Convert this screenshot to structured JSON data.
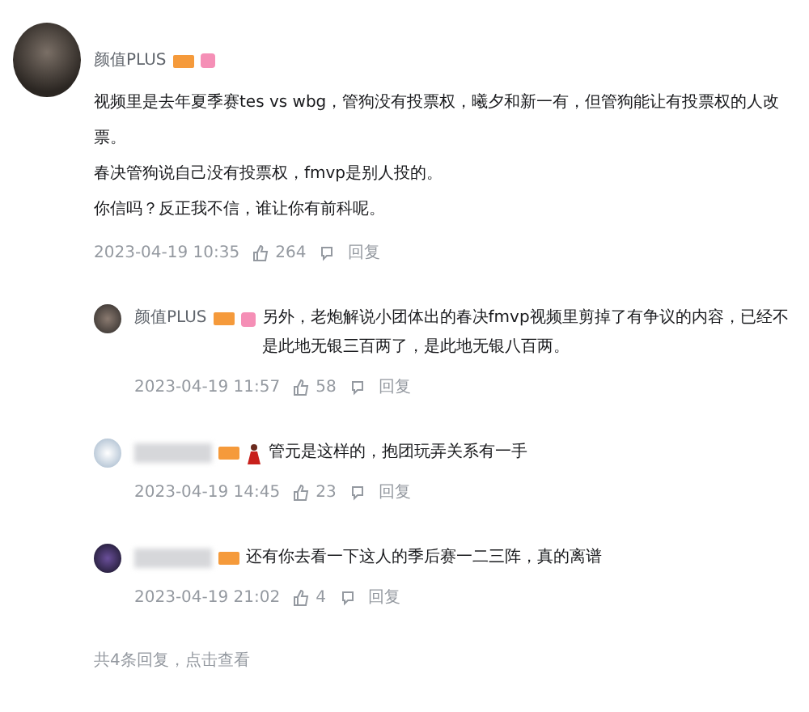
{
  "comment": {
    "user": "颜值PLUS",
    "up_badge": true,
    "lines": [
      "视频里是去年夏季赛tes vs wbg，管狗没有投票权，曦夕和新一有，但管狗能让有投票权的人改票。",
      "春决管狗说自己没有投票权，fmvp是别人投的。",
      "你信吗？反正我不信，谁让你有前科呢。"
    ],
    "time": "2023-04-19 10:35",
    "likes": "264",
    "reply_label": "回复"
  },
  "replies": [
    {
      "user": "颜值PLUS",
      "name_blurred": false,
      "up_badge": true,
      "emoji": false,
      "text": "另外，老炮解说小团体出的春决fmvp视频里剪掉了有争议的内容，已经不是此地无银三百两了，是此地无银八百两。",
      "time": "2023-04-19 11:57",
      "likes": "58",
      "reply_label": "回复"
    },
    {
      "name_blurred": true,
      "up_badge": false,
      "emoji": true,
      "text": "管元是这样的，抱团玩弄关系有一手",
      "time": "2023-04-19 14:45",
      "likes": "23",
      "reply_label": "回复"
    },
    {
      "name_blurred": true,
      "up_badge": false,
      "emoji": false,
      "text": "还有你去看一下这人的季后赛一二三阵，真的离谱",
      "time": "2023-04-19 21:02",
      "likes": "4",
      "reply_label": "回复"
    }
  ],
  "footer": "共4条回复，点击查看"
}
